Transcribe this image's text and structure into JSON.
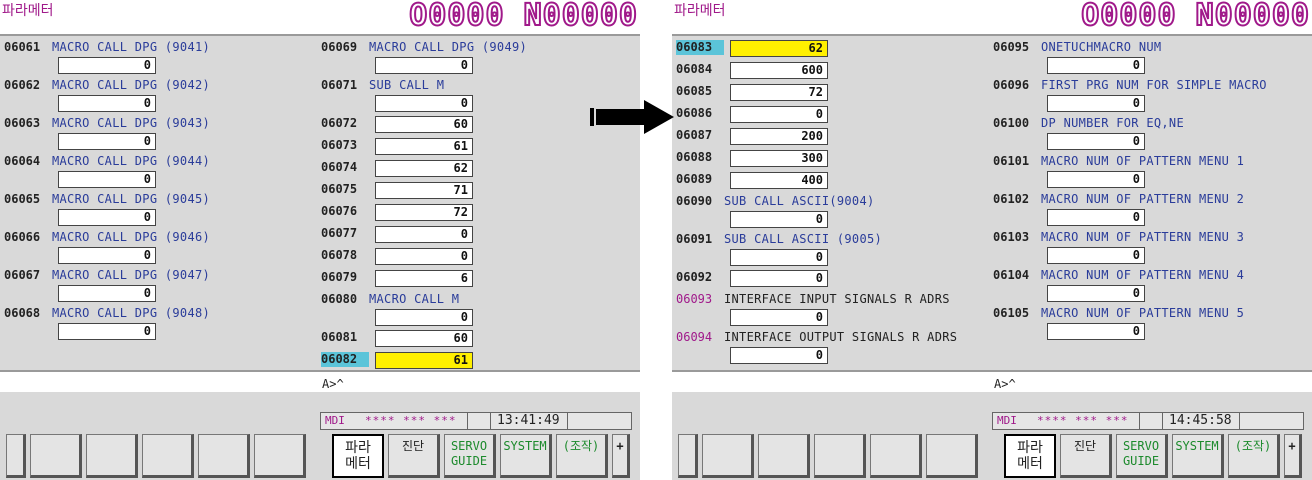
{
  "screens": [
    {
      "title": "파라메터",
      "program": "O0000 N00000",
      "col1": [
        {
          "num": "06061",
          "name": "MACRO CALL DPG (9041)",
          "value": "0"
        },
        {
          "num": "06062",
          "name": "MACRO CALL DPG (9042)",
          "value": "0"
        },
        {
          "num": "06063",
          "name": "MACRO CALL DPG (9043)",
          "value": "0"
        },
        {
          "num": "06064",
          "name": "MACRO CALL DPG (9044)",
          "value": "0"
        },
        {
          "num": "06065",
          "name": "MACRO CALL DPG (9045)",
          "value": "0"
        },
        {
          "num": "06066",
          "name": "MACRO CALL DPG (9046)",
          "value": "0"
        },
        {
          "num": "06067",
          "name": "MACRO CALL DPG (9047)",
          "value": "0"
        },
        {
          "num": "06068",
          "name": "MACRO CALL DPG (9048)",
          "value": "0"
        }
      ],
      "col2": [
        {
          "num": "06069",
          "name": "MACRO CALL DPG (9049)",
          "value": "0"
        },
        {
          "num": "06071",
          "name": "SUB CALL M",
          "value": "0"
        },
        {
          "num": "06072",
          "name": "",
          "value": "60"
        },
        {
          "num": "06073",
          "name": "",
          "value": "61"
        },
        {
          "num": "06074",
          "name": "",
          "value": "62"
        },
        {
          "num": "06075",
          "name": "",
          "value": "71"
        },
        {
          "num": "06076",
          "name": "",
          "value": "72"
        },
        {
          "num": "06077",
          "name": "",
          "value": "0"
        },
        {
          "num": "06078",
          "name": "",
          "value": "0"
        },
        {
          "num": "06079",
          "name": "",
          "value": "6"
        },
        {
          "num": "06080",
          "name": "MACRO CALL M",
          "value": "0"
        },
        {
          "num": "06081",
          "name": "",
          "value": "60"
        },
        {
          "num": "06082",
          "name": "",
          "value": "61",
          "selected": true
        }
      ],
      "prompt": "A>^",
      "mode": "MDI",
      "stars": "**** *** ***",
      "time": "13:41:49"
    },
    {
      "title": "파라메터",
      "program": "O0000 N00000",
      "col1": [
        {
          "num": "06083",
          "name": "",
          "value": "62",
          "selected": true
        },
        {
          "num": "06084",
          "name": "",
          "value": "600"
        },
        {
          "num": "06085",
          "name": "",
          "value": "72"
        },
        {
          "num": "06086",
          "name": "",
          "value": "0"
        },
        {
          "num": "06087",
          "name": "",
          "value": "200"
        },
        {
          "num": "06088",
          "name": "",
          "value": "300"
        },
        {
          "num": "06089",
          "name": "",
          "value": "400"
        },
        {
          "num": "06090",
          "name": "SUB CALL ASCII(9004)",
          "value": "0"
        },
        {
          "num": "06091",
          "name": "SUB CALL ASCII (9005)",
          "value": "0"
        },
        {
          "num": "06092",
          "name": "",
          "value": "0"
        },
        {
          "num": "06093",
          "name": "INTERFACE INPUT SIGNALS R ADRS",
          "value": "0",
          "magenta": true
        },
        {
          "num": "06094",
          "name": "INTERFACE OUTPUT SIGNALS R ADRS",
          "value": "0",
          "magenta": true
        }
      ],
      "col2": [
        {
          "num": "06095",
          "name": "ONETUCHMACRO NUM",
          "value": "0"
        },
        {
          "num": "06096",
          "name": "FIRST PRG NUM FOR SIMPLE MACRO",
          "value": "0"
        },
        {
          "num": "06100",
          "name": "DP NUMBER FOR EQ,NE",
          "value": "0"
        },
        {
          "num": "06101",
          "name": "MACRO NUM OF PATTERN MENU 1",
          "value": "0"
        },
        {
          "num": "06102",
          "name": "MACRO NUM OF PATTERN MENU 2",
          "value": "0"
        },
        {
          "num": "06103",
          "name": "MACRO NUM OF PATTERN MENU 3",
          "value": "0"
        },
        {
          "num": "06104",
          "name": "MACRO NUM OF PATTERN MENU 4",
          "value": "0"
        },
        {
          "num": "06105",
          "name": "MACRO NUM OF PATTERN MENU 5",
          "value": "0"
        }
      ],
      "prompt": "A>^",
      "mode": "MDI",
      "stars": "**** *** ***",
      "time": "14:45:58"
    }
  ],
  "softkeys": {
    "param_line1": "파라",
    "param_line2": "메터",
    "diag": "진단",
    "servo_line1": "SERVO",
    "servo_line2": "GUIDE",
    "system": "SYSTEM",
    "operate": "(조작)",
    "plus": "+"
  },
  "colors": {
    "title": "#a0198a",
    "panel": "#d9d9d9",
    "name_text": "#2a3c9a",
    "highlight_value": "#fff000",
    "highlight_num": "#5bc4d9",
    "servo_text": "#1c8a2c"
  }
}
